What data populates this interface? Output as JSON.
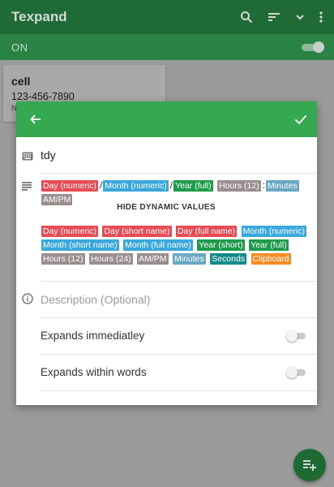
{
  "appbar": {
    "title": "Texpand"
  },
  "onbar": {
    "label": "ON"
  },
  "card": {
    "name": "cell",
    "phone": "123-456-7890",
    "tiny": "N"
  },
  "dialog": {
    "shortcut": "tdy",
    "phrase": {
      "tokens": [
        "Day (numeric)",
        "Month (numeric)",
        "Year (full)",
        "Hours (12)",
        "Minutes",
        "AM/PM"
      ],
      "separators": [
        "/",
        "/",
        ":"
      ]
    },
    "hide_dynamic_label": "HIDE DYNAMIC VALUES",
    "dynamic_values": [
      "Day (numeric)",
      "Day (short name)",
      "Day (full name)",
      "Month (numeric)",
      "Month (short name)",
      "Month (full name)",
      "Year (short)",
      "Year (full)",
      "Hours (12)",
      "Hours (24)",
      "AM/PM",
      "Minutes",
      "Seconds",
      "Clipboard"
    ],
    "description_placeholder": "Description (Optional)",
    "toggles": {
      "expands_immediately": "Expands immediatley",
      "expands_within_words": "Expands within words"
    }
  },
  "colors": {
    "header_green": "#35a951",
    "appbar_dim": "#1f6a36",
    "token_red": "#e84b53",
    "token_blue": "#3aa7dd",
    "token_green": "#1d9a4a",
    "token_gray": "#9a8f8f",
    "token_teal": "#6aa7c0",
    "token_dark_teal": "#138b8a",
    "token_orange": "#f48b23"
  }
}
